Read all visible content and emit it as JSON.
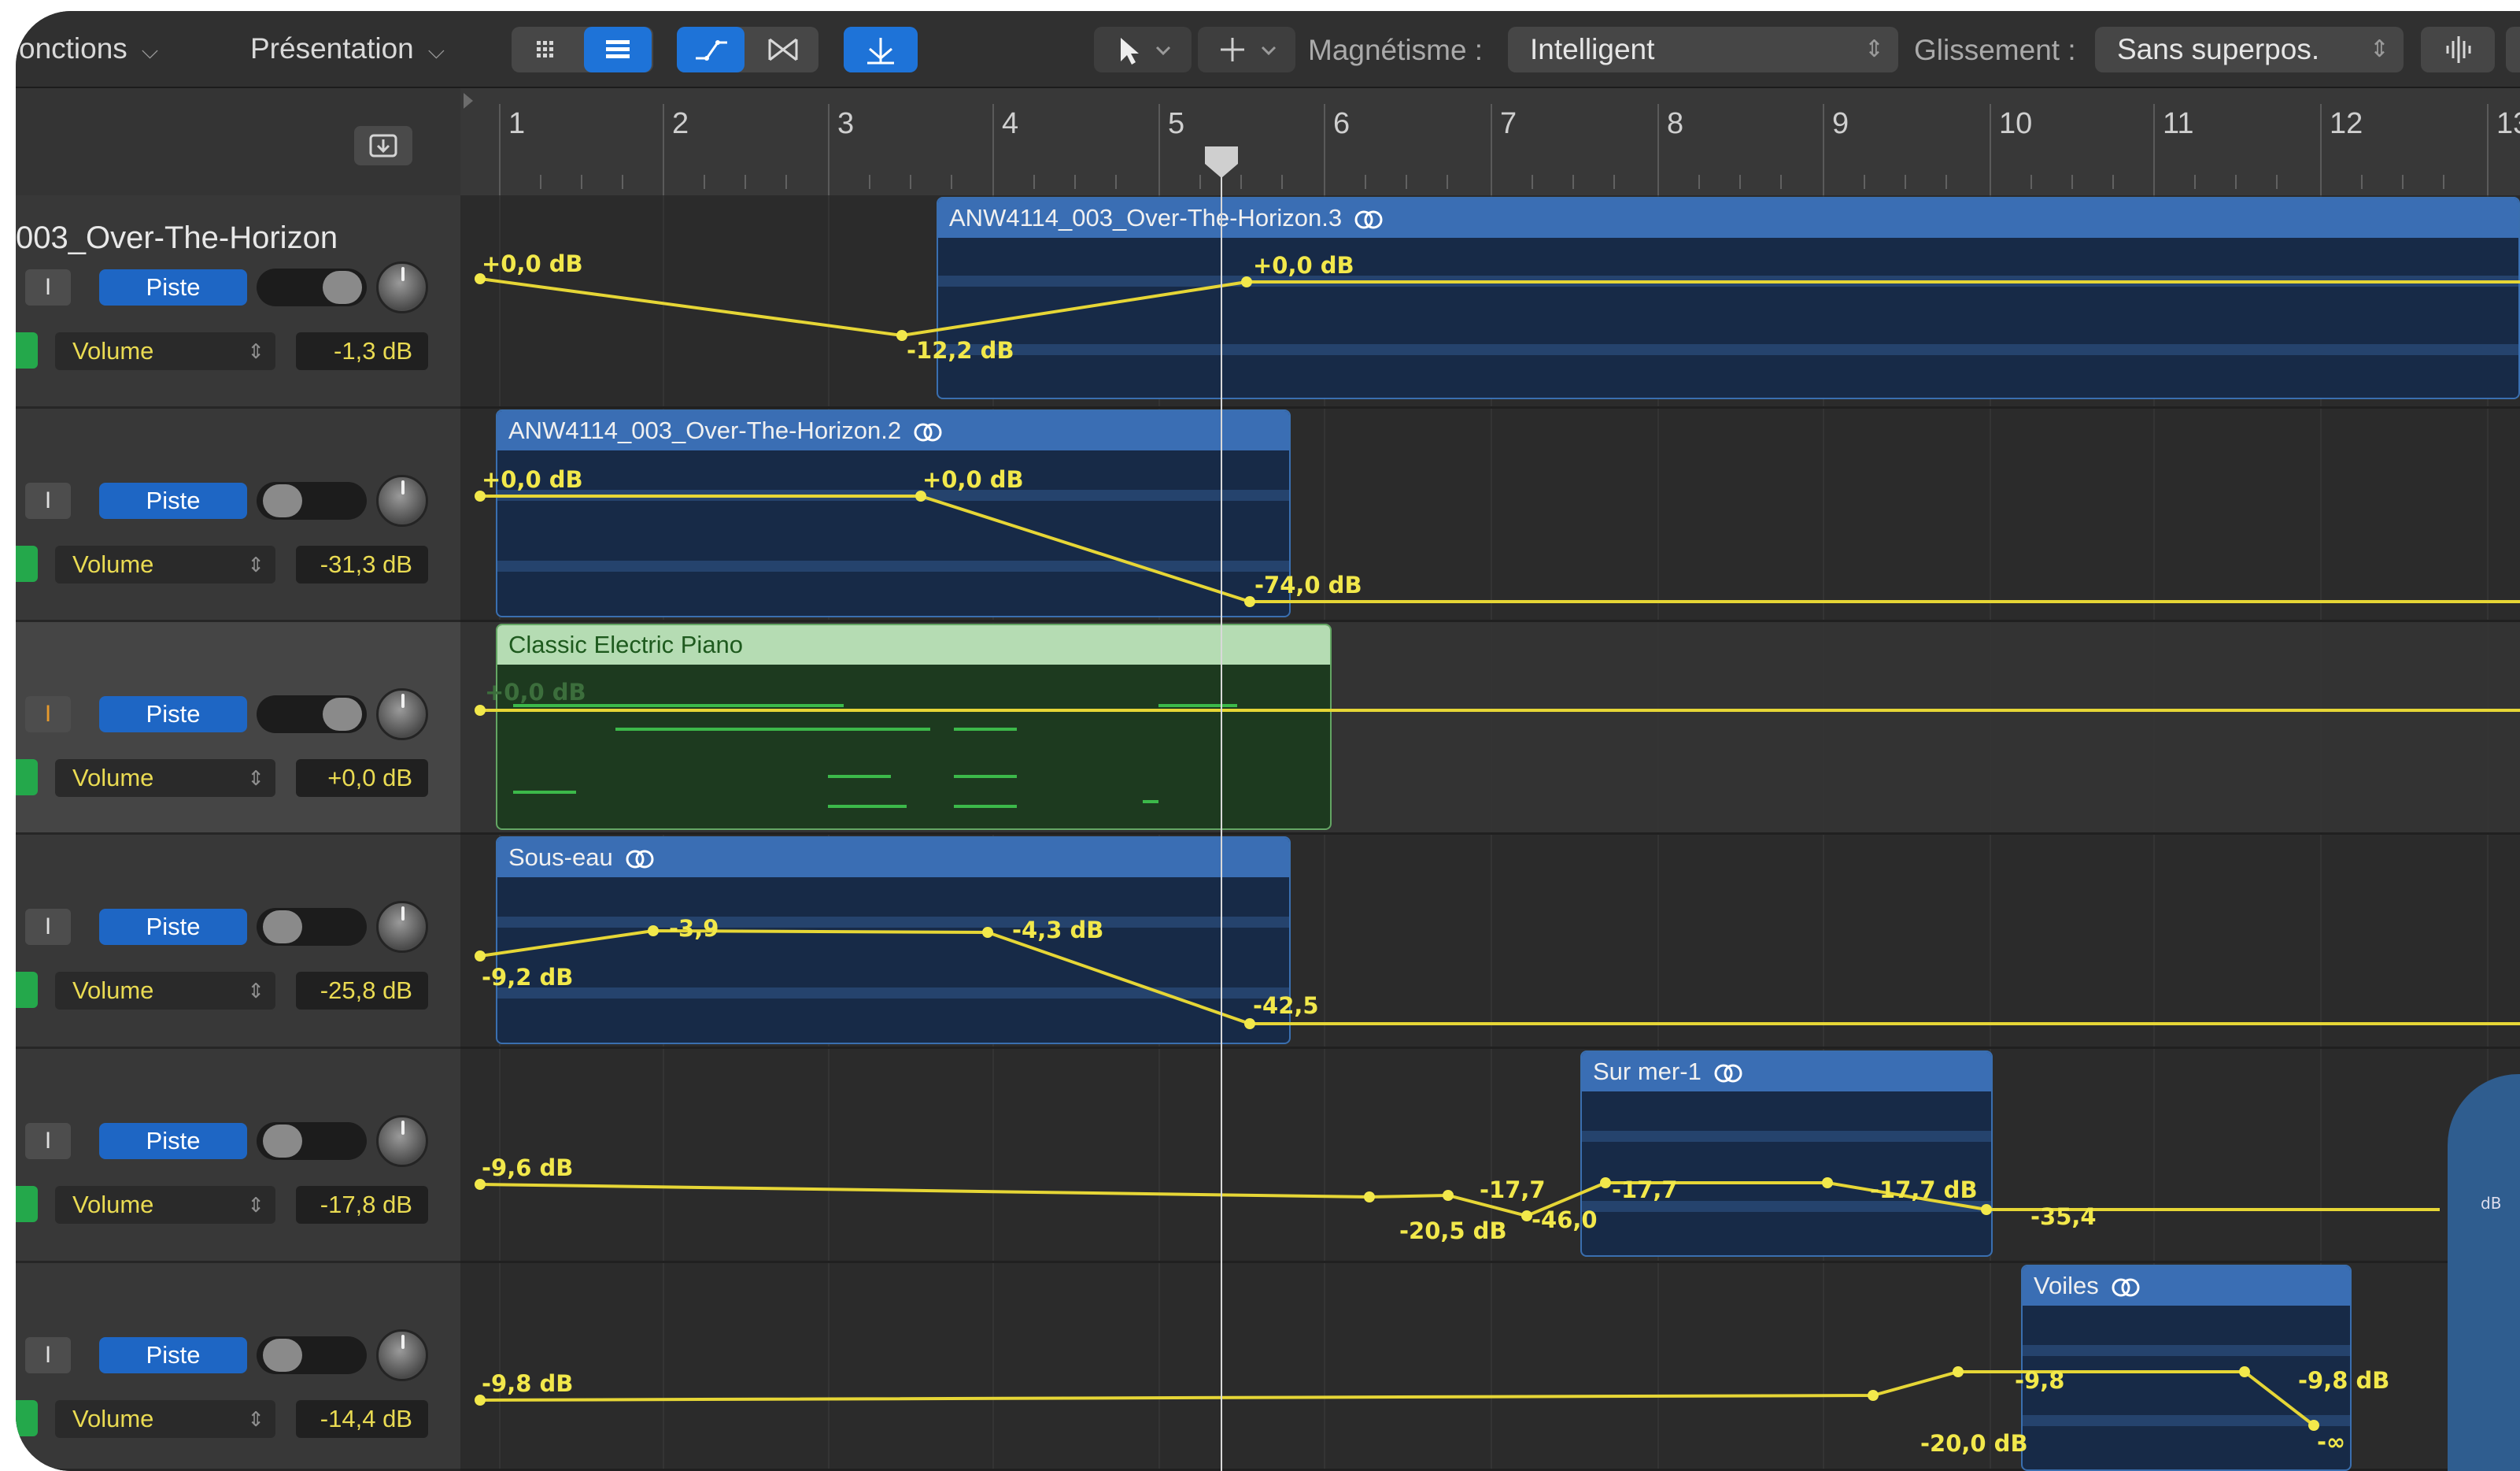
{
  "toolbar": {
    "fonctions_label": "onctions",
    "presentation_label": "Présentation",
    "magnetisme_label": "Magnétisme :",
    "magnetisme_value": "Intelligent",
    "glissement_label": "Glissement :",
    "glissement_value": "Sans superpos.",
    "accent_color": "#1e73d8"
  },
  "ruler": {
    "bars": [
      "1",
      "2",
      "3",
      "4",
      "5",
      "6",
      "7",
      "8",
      "9",
      "10",
      "11",
      "12",
      "13"
    ]
  },
  "tracks": [
    {
      "name": "003_Over-The-Horizon",
      "mute_label": "I",
      "mode_label": "Piste",
      "param": "Volume",
      "value": "-1,3 dB",
      "mute_orange": false
    },
    {
      "name": "",
      "mute_label": "I",
      "mode_label": "Piste",
      "param": "Volume",
      "value": "-31,3 dB",
      "mute_orange": false
    },
    {
      "name": "",
      "mute_label": "I",
      "mode_label": "Piste",
      "param": "Volume",
      "value": "+0,0 dB",
      "mute_orange": true
    },
    {
      "name": "",
      "mute_label": "I",
      "mode_label": "Piste",
      "param": "Volume",
      "value": "-25,8 dB",
      "mute_orange": false
    },
    {
      "name": "",
      "mute_label": "I",
      "mode_label": "Piste",
      "param": "Volume",
      "value": "-17,8 dB",
      "mute_orange": false
    },
    {
      "name": "",
      "mute_label": "I",
      "mode_label": "Piste",
      "param": "Volume",
      "value": "-14,4 dB",
      "mute_orange": false
    }
  ],
  "regions": [
    {
      "name": "ANW4114_003_Over-The-Horizon.3",
      "type": "audio"
    },
    {
      "name": "ANW4114_003_Over-The-Horizon.2",
      "type": "audio"
    },
    {
      "name": "Classic Electric Piano",
      "type": "midi"
    },
    {
      "name": "Sous-eau",
      "type": "audio"
    },
    {
      "name": "Sur mer-1",
      "type": "audio"
    },
    {
      "name": "Voiles",
      "type": "audio"
    }
  ],
  "automation_labels": {
    "t1a": "+0,0 dB",
    "t1b": "-12,2 dB",
    "t1c": "+0,0 dB",
    "t2a": "+0,0 dB",
    "t2b": "+0,0 dB",
    "t2c": "-74,0 dB",
    "t3a": "+0,0 dB",
    "t4a": "-9,2 dB",
    "t4b": "-3,9",
    "t4c": "-4,3 dB",
    "t4d": "-42,5",
    "t5a": "-9,6 dB",
    "t5b": "-20,5 dB",
    "t5c": "-17,7",
    "t5d": "-46,0",
    "t5e": "-17,7",
    "t5f": "-17,7 dB",
    "t5g": "-35,4",
    "t6a": "-9,8 dB",
    "t6b": "-20,0 dB",
    "t6c": "-9,8",
    "t6d": "-9,8 dB",
    "t6e": "-∞",
    "db_tag": "dB"
  },
  "colors": {
    "automation": "#f2e84b",
    "audio_region": "#3a6eb4",
    "midi_region": "#b5dcb3",
    "piste_button": "#1e66c4"
  }
}
